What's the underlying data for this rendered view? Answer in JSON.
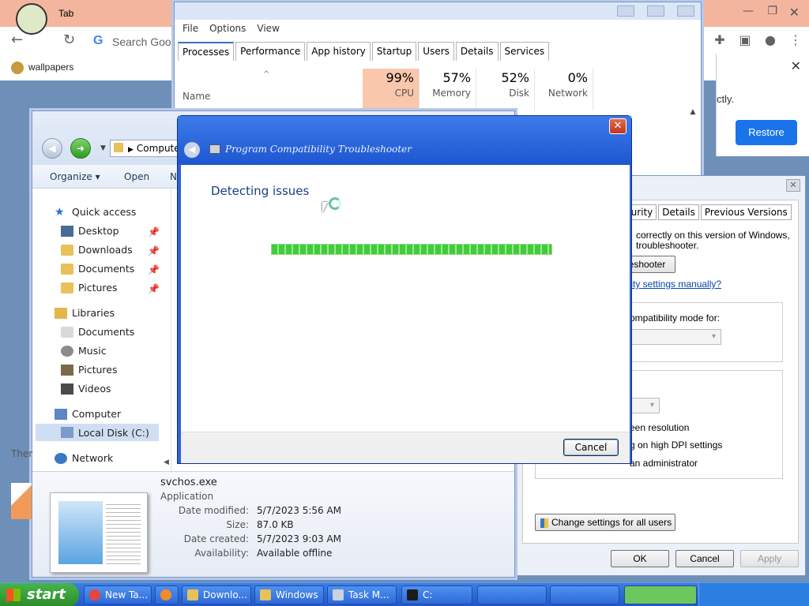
{
  "browser": {
    "tab_label": "Tab",
    "address_placeholder": "Search Goo",
    "bookmark": "wallpapers"
  },
  "restore_popup": {
    "message_fragment": "ctly.",
    "restore_label": "Restore"
  },
  "task_manager": {
    "menu": [
      "File",
      "Options",
      "View"
    ],
    "tabs": [
      "Processes",
      "Performance",
      "App history",
      "Startup",
      "Users",
      "Details",
      "Services"
    ],
    "selected_tab": "Processes",
    "name_header": "Name",
    "columns": [
      {
        "value": "99%",
        "label": "CPU"
      },
      {
        "value": "57%",
        "label": "Memory"
      },
      {
        "value": "52%",
        "label": "Disk"
      },
      {
        "value": "0%",
        "label": "Network"
      }
    ]
  },
  "explorer": {
    "breadcrumb": "Compute",
    "commands": [
      "Organize ▾",
      "Open",
      "N"
    ],
    "nav": [
      {
        "label": "Quick access",
        "icon": "star-icon",
        "indent": 0
      },
      {
        "label": "Desktop",
        "icon": "desktop-icon",
        "indent": 1,
        "pinned": true
      },
      {
        "label": "Downloads",
        "icon": "folder-icon",
        "indent": 1,
        "pinned": true
      },
      {
        "label": "Documents",
        "icon": "folder-icon",
        "indent": 1,
        "pinned": true
      },
      {
        "label": "Pictures",
        "icon": "folder-icon",
        "indent": 1,
        "pinned": true
      },
      {
        "label": "Libraries",
        "icon": "library-icon",
        "indent": 0
      },
      {
        "label": "Documents",
        "icon": "documents-icon",
        "indent": 1
      },
      {
        "label": "Music",
        "icon": "music-icon",
        "indent": 1
      },
      {
        "label": "Pictures",
        "icon": "pictures-icon",
        "indent": 1
      },
      {
        "label": "Videos",
        "icon": "videos-icon",
        "indent": 1
      },
      {
        "label": "Computer",
        "icon": "computer-icon",
        "indent": 0
      },
      {
        "label": "Local Disk (C:)",
        "icon": "disk-icon",
        "indent": 1,
        "selected": true
      },
      {
        "label": "Network",
        "icon": "network-icon",
        "indent": 0
      }
    ],
    "details": {
      "filename": "svchos.exe",
      "type": "Application",
      "props": [
        {
          "k": "Date modified:",
          "v": "5/7/2023 5:56 AM"
        },
        {
          "k": "Size:",
          "v": "87.0 KB"
        },
        {
          "k": "Date created:",
          "v": "5/7/2023 9:03 AM"
        },
        {
          "k": "Availability:",
          "v": "Available offline"
        }
      ]
    }
  },
  "properties": {
    "tabs": [
      "curity",
      "Details",
      "Previous Versions"
    ],
    "line1": "correctly on this version of Windows,",
    "line2": "troubleshooter.",
    "run_button": "eshooter",
    "manual_link": "ility settings manually?",
    "compat_mode": "ompatibility mode for:",
    "opt1": "een resolution",
    "opt2": "g on high DPI settings",
    "opt3": "an administrator",
    "change_all": "Change settings for all users",
    "ok": "OK",
    "cancel": "Cancel",
    "apply": "Apply"
  },
  "troubleshooter": {
    "title": "Program Compatibility Troubleshooter",
    "heading": "Detecting issues",
    "cancel": "Cancel"
  },
  "left_fragment": "Ther",
  "taskbar": {
    "start": "start",
    "items": [
      "New Ta...",
      "",
      "Downlo...",
      "Windows",
      "Task M...",
      "C:"
    ]
  },
  "colors": {
    "xp_title_blue": "#2f62d6",
    "task_highlight": "#f9c7ac",
    "restore_blue": "#1a73e8",
    "progress_green": "#3fce39"
  }
}
